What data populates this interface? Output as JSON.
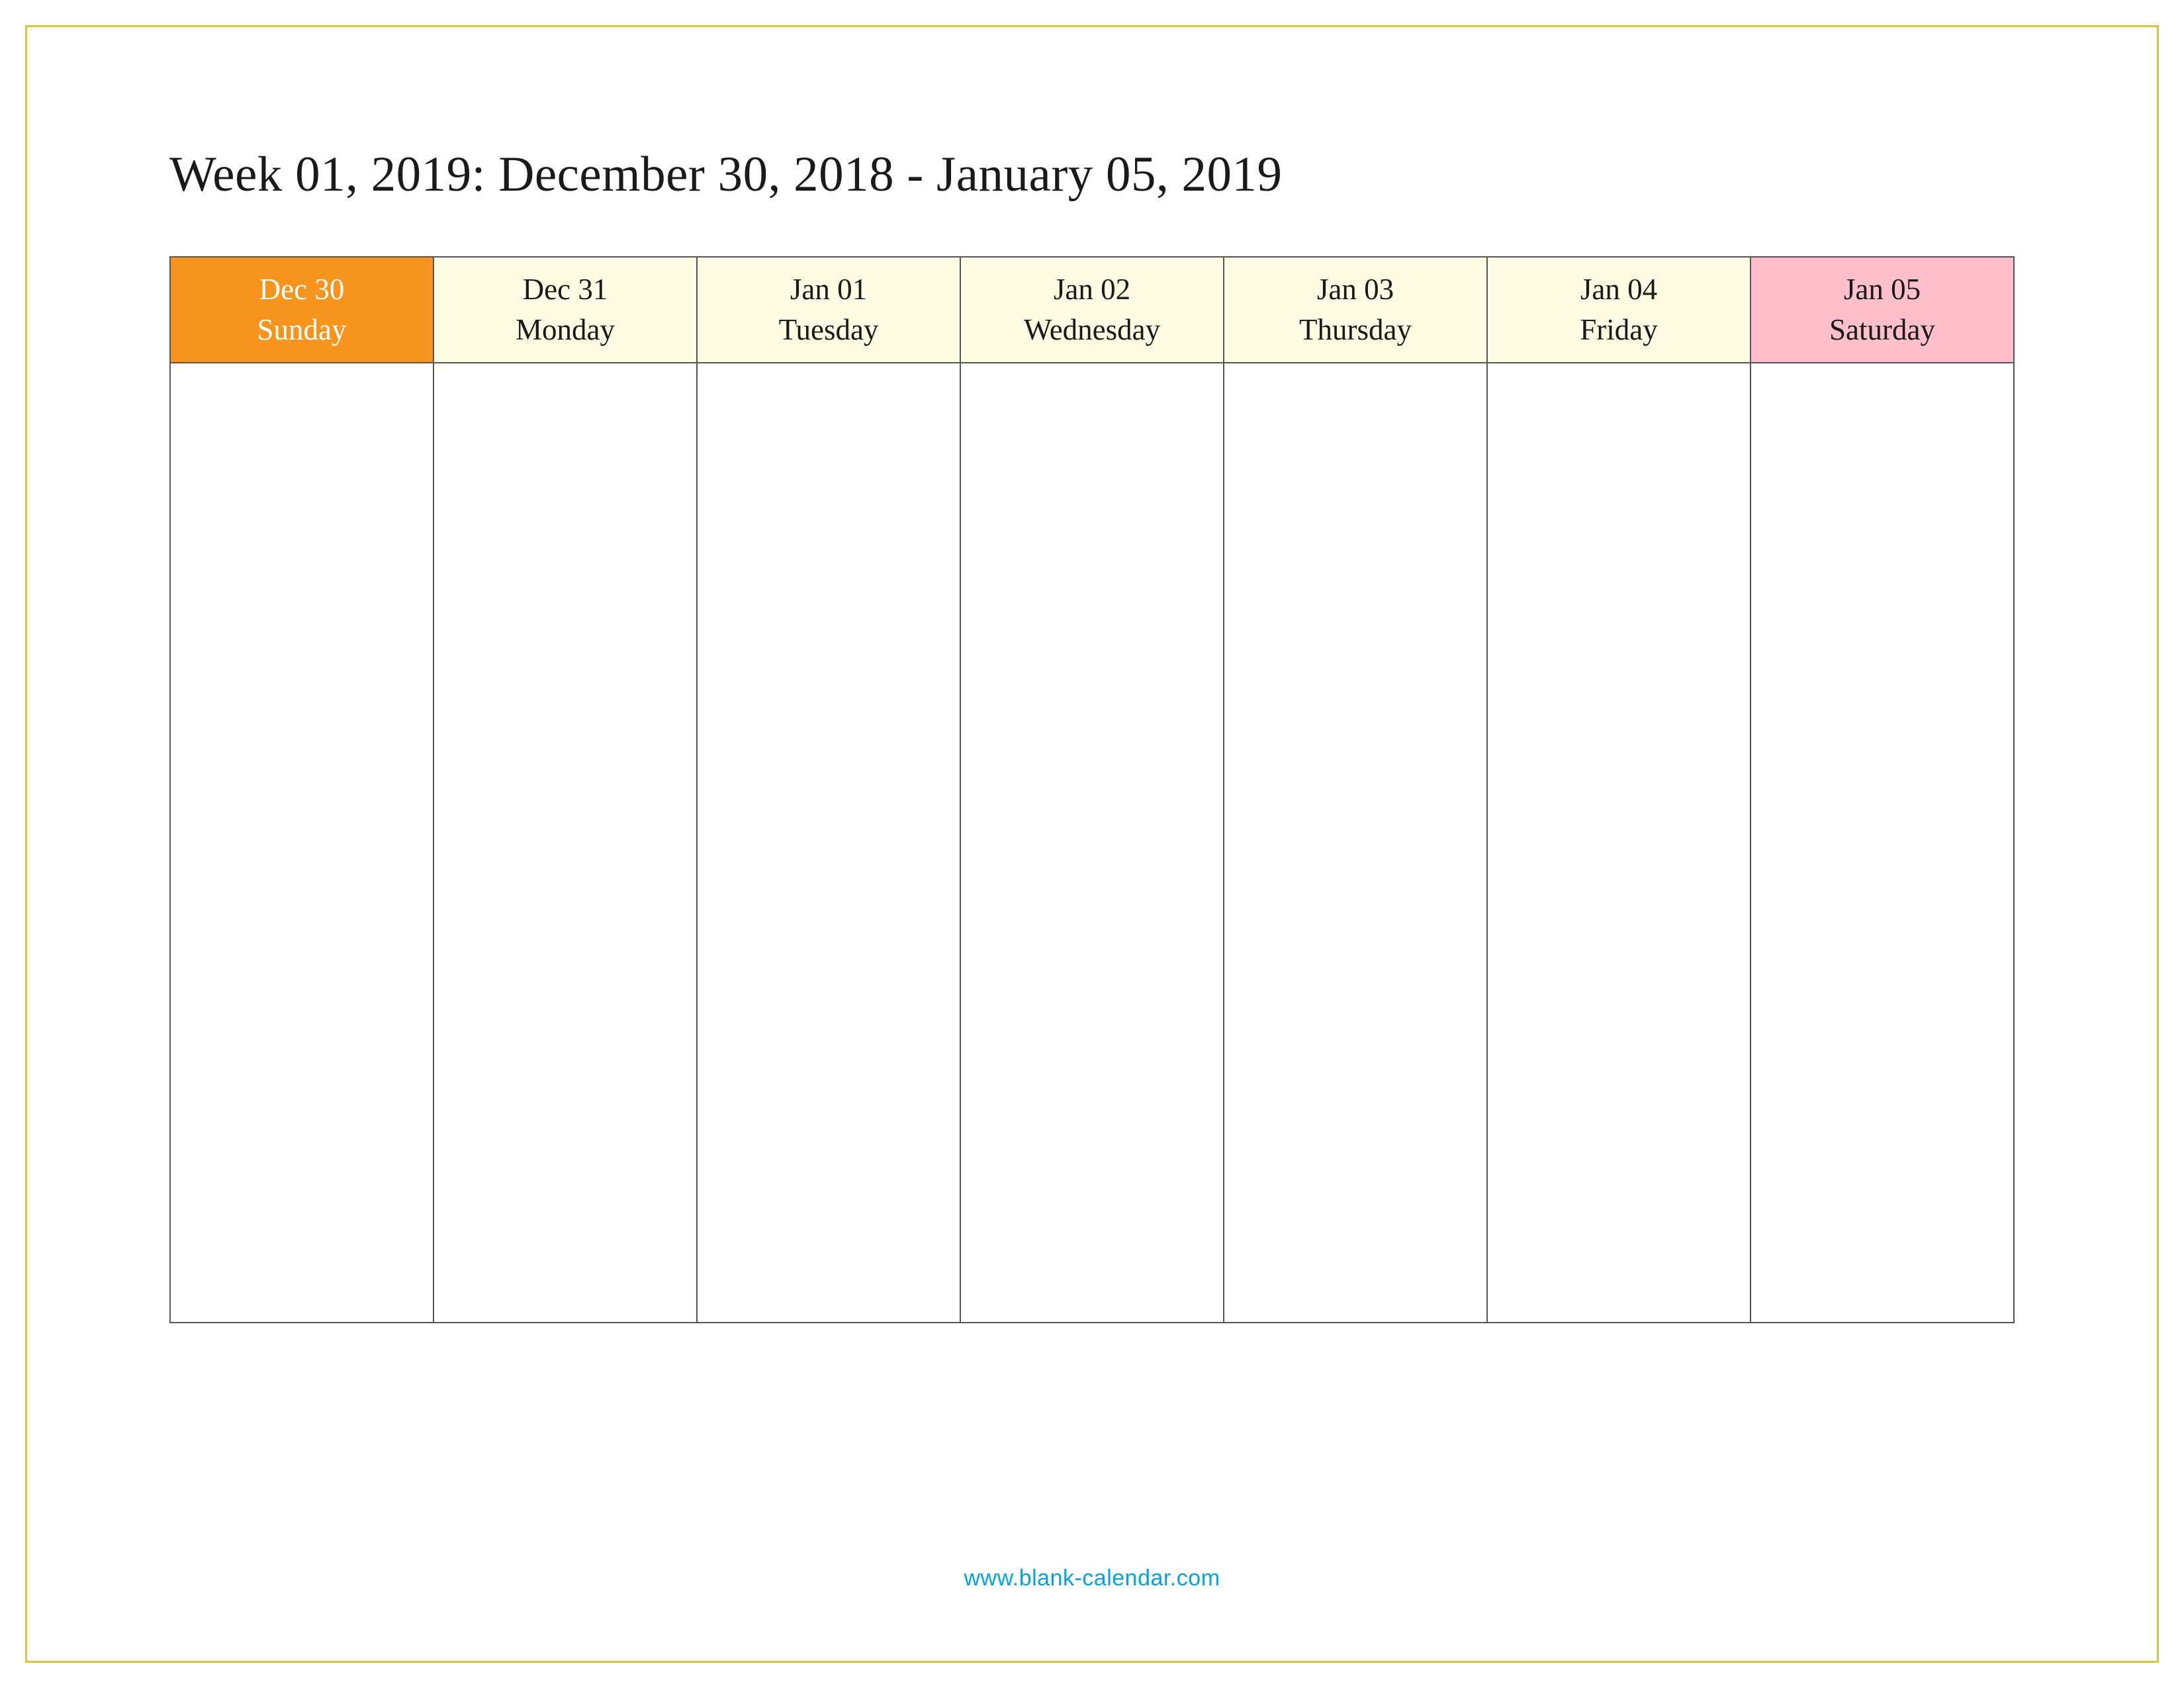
{
  "title": "Week 01, 2019: December 30, 2018 - January 05, 2019",
  "days": [
    {
      "date": "Dec 30",
      "name": "Sunday"
    },
    {
      "date": "Dec 31",
      "name": "Monday"
    },
    {
      "date": "Jan 01",
      "name": "Tuesday"
    },
    {
      "date": "Jan 02",
      "name": "Wednesday"
    },
    {
      "date": "Jan 03",
      "name": "Thursday"
    },
    {
      "date": "Jan 04",
      "name": "Friday"
    },
    {
      "date": "Jan 05",
      "name": "Saturday"
    }
  ],
  "footer": "www.blank-calendar.com",
  "colors": {
    "page_border": "#d7c443",
    "sunday_bg": "#f7941d",
    "weekday_bg": "#fdfbe2",
    "saturday_bg": "#ffc0cb",
    "link": "#00a4e4"
  }
}
